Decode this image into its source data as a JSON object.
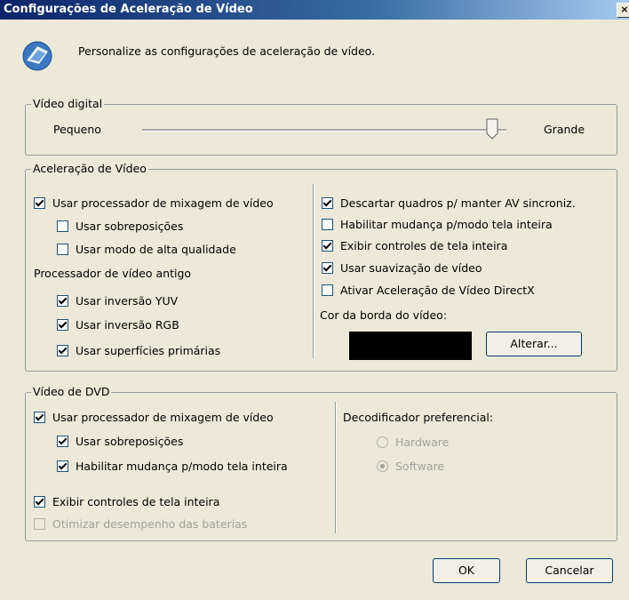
{
  "window": {
    "title": "Configurações de Aceleração de Vídeo",
    "close_label": "×"
  },
  "header": {
    "text": "Personalize as configurações de aceleração de vídeo."
  },
  "video_digital": {
    "legend": "Vídeo digital",
    "small_label": "Pequeno",
    "large_label": "Grande",
    "slider_value_fraction": 0.95
  },
  "acceleration": {
    "legend": "Aceleração de Vídeo",
    "use_mixer": {
      "label": "Usar processador de mixagem de vídeo",
      "checked": true
    },
    "use_overlays": {
      "label": "Usar sobreposições",
      "checked": false
    },
    "high_quality": {
      "label": "Usar modo de alta qualidade",
      "checked": false
    },
    "legacy_label": "Processador de vídeo antigo",
    "yuv": {
      "label": "Usar inversão YUV",
      "checked": true
    },
    "rgb": {
      "label": "Usar inversão RGB",
      "checked": true
    },
    "primary": {
      "label": "Usar superfícies primárias",
      "checked": true
    },
    "drop_frames": {
      "label": "Descartar quadros p/ manter AV sincroniz.",
      "checked": true
    },
    "fullscreen_switch": {
      "label": "Habilitar mudança p/modo tela inteira",
      "checked": false
    },
    "fullscreen_controls": {
      "label": "Exibir controles de tela inteira",
      "checked": true
    },
    "smoothing": {
      "label": "Usar suavização de vídeo",
      "checked": true
    },
    "directx": {
      "label": "Ativar Aceleração de Vídeo DirectX",
      "checked": false
    },
    "border_color_label": "Cor da borda do vídeo:",
    "border_color": "#000000",
    "change_button": "Alterar..."
  },
  "dvd": {
    "legend": "Vídeo de DVD",
    "use_mixer": {
      "label": "Usar processador de mixagem de vídeo",
      "checked": true
    },
    "use_overlays": {
      "label": "Usar sobreposições",
      "checked": true
    },
    "fullscreen_switch": {
      "label": "Habilitar mudança p/modo tela inteira",
      "checked": true
    },
    "fullscreen_controls": {
      "label": "Exibir controles de tela inteira",
      "checked": true
    },
    "battery": {
      "label": "Otimizar desempenho das baterias",
      "checked": false,
      "disabled": true
    },
    "decoder_label": "Decodificador preferencial:",
    "hardware": {
      "label": "Hardware",
      "selected": false
    },
    "software": {
      "label": "Software",
      "selected": true
    }
  },
  "footer": {
    "ok": "OK",
    "cancel": "Cancelar"
  }
}
